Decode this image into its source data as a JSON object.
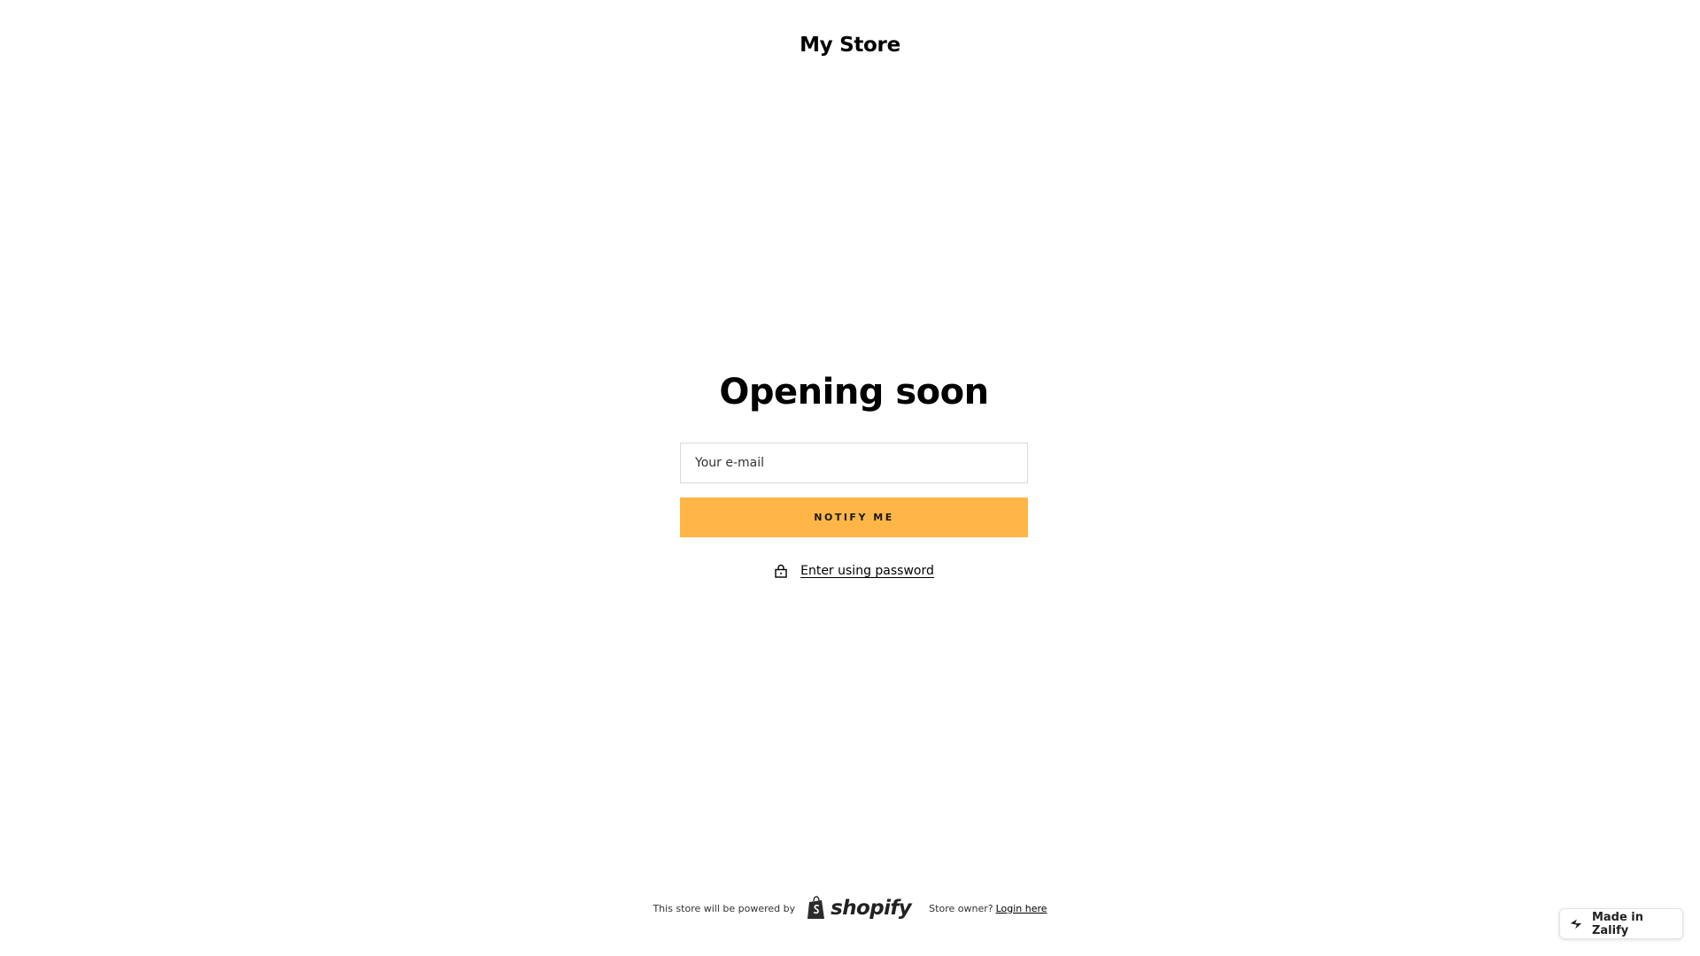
{
  "header": {
    "store_name": "My Store"
  },
  "main": {
    "heading": "Opening soon",
    "email_placeholder": "Your e-mail",
    "notify_label": "NOTIFY ME",
    "password_label": "Enter using password"
  },
  "footer": {
    "powered_text": "This store will be powered by",
    "logo_text": "shopify",
    "owner_text": "Store owner?",
    "login_label": "Login here"
  },
  "badge": {
    "label": "Made in Zalify"
  },
  "colors": {
    "accent": "#ffb647",
    "text": "#000000",
    "border": "#d9d9d9"
  }
}
